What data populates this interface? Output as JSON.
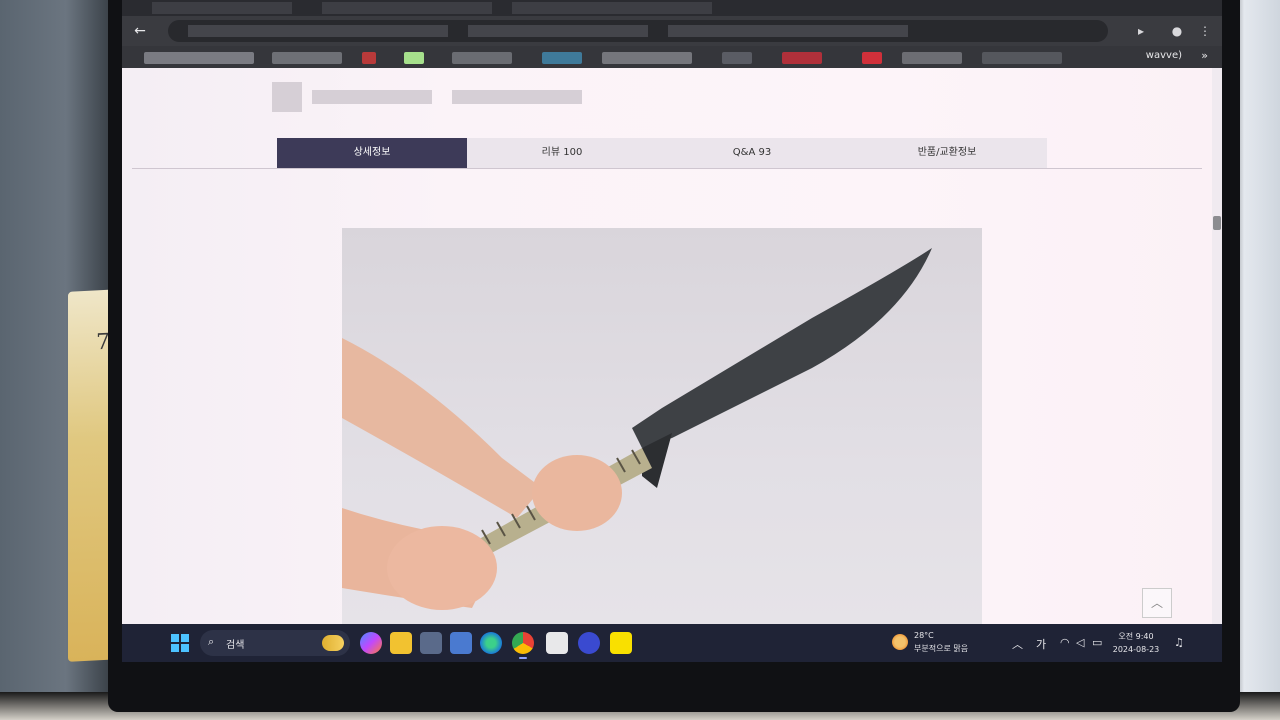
{
  "browser": {
    "back_icon": "←",
    "bookmark_label": "wavve)",
    "more_bookmarks_icon": "»"
  },
  "product_tabs": [
    {
      "label": "상세정보",
      "active": true
    },
    {
      "label": "리뷰 100",
      "active": false
    },
    {
      "label": "Q&A 93",
      "active": false
    },
    {
      "label": "반품/교환정보",
      "active": false
    }
  ],
  "scroll_top_icon": "︿",
  "taskbar": {
    "search_label": "검색",
    "search_icon": "search-icon",
    "weather_temp": "28°C",
    "weather_condition": "부분적으로 맑음",
    "ime_label": "가",
    "time": "오전 9:40",
    "date": "2024-08-23"
  },
  "calendar_number": "7",
  "colors": {
    "active_tab": "#3d3a58",
    "taskbar": "#1f2336"
  }
}
